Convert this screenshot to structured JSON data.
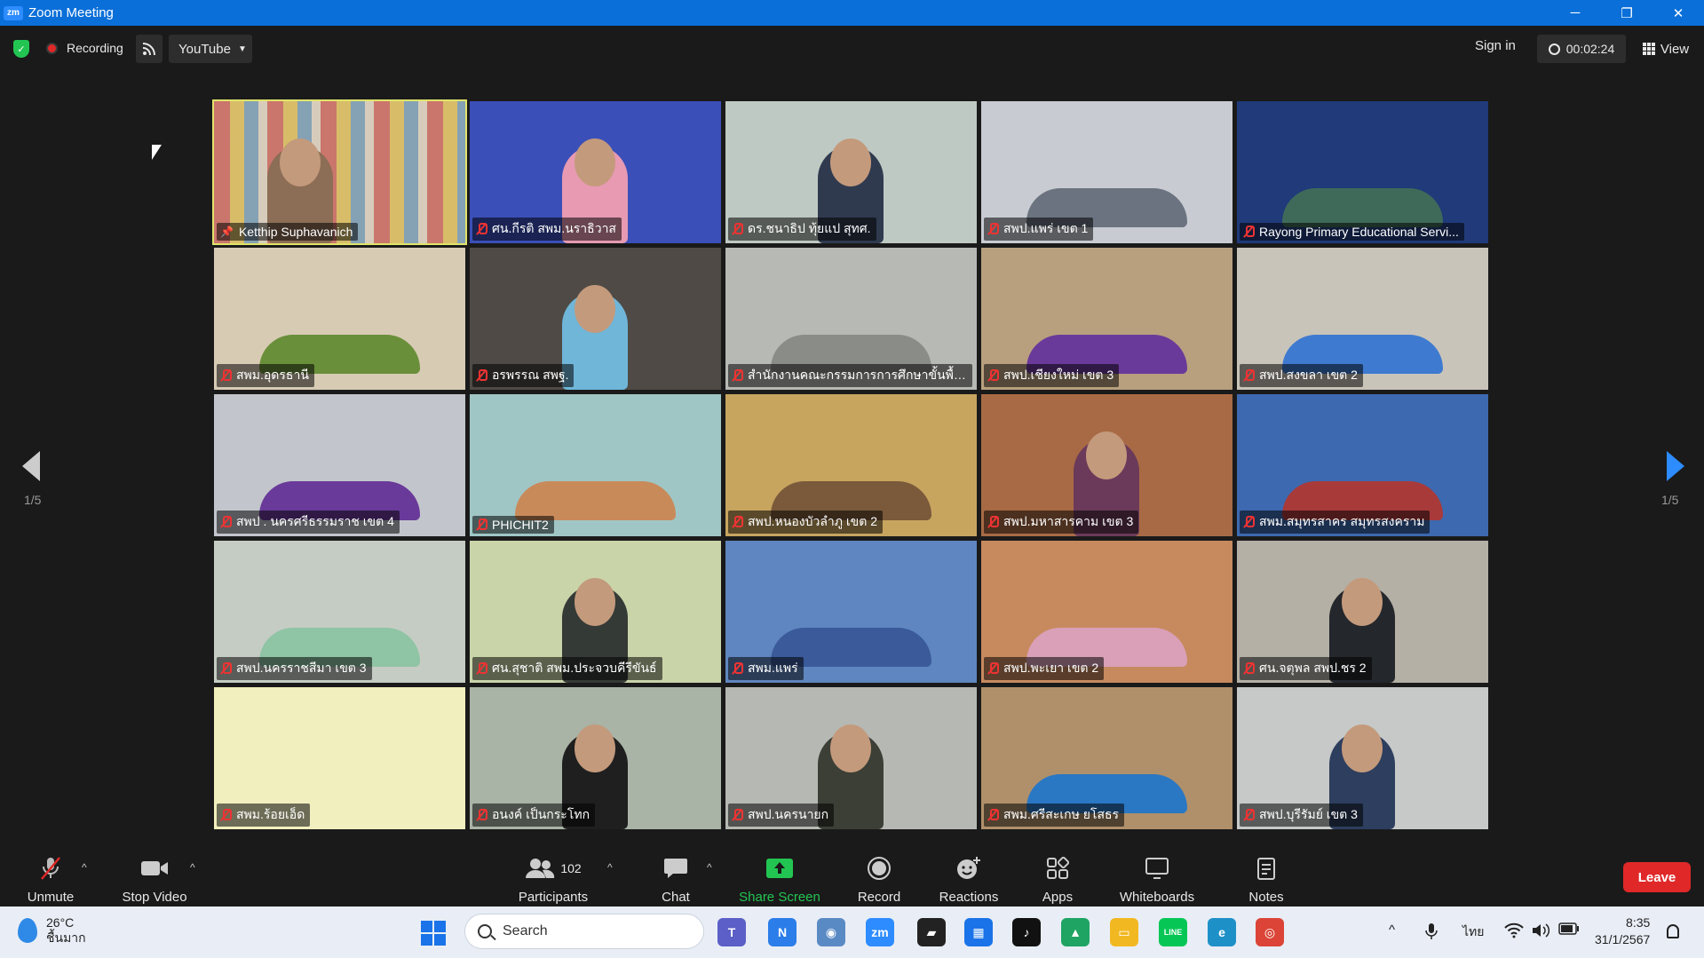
{
  "window": {
    "app_logo": "zm",
    "title": "Zoom Meeting",
    "controls": [
      "─",
      "❐",
      "✕"
    ]
  },
  "topbar": {
    "security_icon": "shield-icon",
    "recording_label": "Recording",
    "stream_icon": "rss-icon",
    "stream_target": "YouTube",
    "sign_in": "Sign in",
    "timer": "00:02:24",
    "view_label": "View"
  },
  "gallery": {
    "page_left": "1/5",
    "page_right": "1/5",
    "tiles": [
      {
        "name": "Ketthip Suphavanich",
        "muted": false,
        "pinned": true,
        "active": true,
        "scene": "books",
        "bg": "#b9a58f",
        "accent": "#8c6d55"
      },
      {
        "name": "ศน.กีรติ สพม.นราธิวาส",
        "muted": true,
        "pinned": false,
        "active": false,
        "scene": "person",
        "bg": "#3b4fb8",
        "accent": "#e79ab2"
      },
      {
        "name": "ดร.ชนาธิป ทุ้ยแป สุทศ.",
        "muted": true,
        "pinned": false,
        "active": false,
        "scene": "person",
        "bg": "#bfc9c3",
        "accent": "#2f3a4f"
      },
      {
        "name": "สพป.แพร่ เขต 1",
        "muted": true,
        "pinned": false,
        "active": false,
        "scene": "room",
        "bg": "#c8ccd2",
        "accent": "#6b7380"
      },
      {
        "name": "Rayong Primary Educational Servi...",
        "muted": true,
        "pinned": false,
        "active": false,
        "scene": "room",
        "bg": "#203a7a",
        "accent": "#3f6a5a"
      },
      {
        "name": "สพม.อุดรธานี",
        "muted": true,
        "pinned": false,
        "active": false,
        "scene": "room",
        "bg": "#d8cbb4",
        "accent": "#6a8f3a"
      },
      {
        "name": "อรพรรณ สพฐ.",
        "muted": true,
        "pinned": false,
        "active": false,
        "scene": "person",
        "bg": "#4f4a45",
        "accent": "#6fb6d9"
      },
      {
        "name": "สำนักงานคณะกรรมการการศึกษาขั้นพื้นฐาน",
        "muted": true,
        "pinned": false,
        "active": false,
        "scene": "room",
        "bg": "#b7b9b4",
        "accent": "#8a8c88"
      },
      {
        "name": "สพป.เชียงใหม่ เขต 3",
        "muted": true,
        "pinned": false,
        "active": false,
        "scene": "room",
        "bg": "#b8a07e",
        "accent": "#6a3a9a"
      },
      {
        "name": "สพป.สงขลา เขต 2",
        "muted": true,
        "pinned": false,
        "active": false,
        "scene": "room",
        "bg": "#c9c4b9",
        "accent": "#3e7ad0"
      },
      {
        "name": "สพป . นครศรีธรรมราช เขต 4",
        "muted": true,
        "pinned": false,
        "active": false,
        "scene": "room",
        "bg": "#c2c6cc",
        "accent": "#6a3a9a"
      },
      {
        "name": "PHICHIT2",
        "muted": true,
        "pinned": false,
        "active": false,
        "scene": "room",
        "bg": "#9fc6c5",
        "accent": "#c98a5a"
      },
      {
        "name": "สพป.หนองบัวลำภู เขต 2",
        "muted": true,
        "pinned": false,
        "active": false,
        "scene": "room",
        "bg": "#c7a55f",
        "accent": "#7a5a3a"
      },
      {
        "name": "สพป.มหาสารคาม เขต 3",
        "muted": true,
        "pinned": false,
        "active": false,
        "scene": "person",
        "bg": "#a86a45",
        "accent": "#6b3a5a"
      },
      {
        "name": "สพม.สมุทรสาคร สมุทรสงคราม",
        "muted": true,
        "pinned": false,
        "active": false,
        "scene": "room",
        "bg": "#3d69b0",
        "accent": "#a83a3a"
      },
      {
        "name": "สพป.นครราชสีมา เขต 3",
        "muted": true,
        "pinned": false,
        "active": false,
        "scene": "room",
        "bg": "#c5ccc4",
        "accent": "#8fc4a4"
      },
      {
        "name": "ศน.สุชาติ สพม.ประจวบคีรีขันธ์",
        "muted": true,
        "pinned": false,
        "active": false,
        "scene": "person",
        "bg": "#c9d4a9",
        "accent": "#343a36"
      },
      {
        "name": "สพม.แพร่",
        "muted": true,
        "pinned": false,
        "active": false,
        "scene": "room",
        "bg": "#5f86c0",
        "accent": "#3a5a9a"
      },
      {
        "name": "สพป.พะเยา เขต 2",
        "muted": true,
        "pinned": false,
        "active": false,
        "scene": "room",
        "bg": "#c78a5f",
        "accent": "#d9a0b8"
      },
      {
        "name": "ศน.จตุพล สพป.ชร 2",
        "muted": true,
        "pinned": false,
        "active": false,
        "scene": "person",
        "bg": "#b4b0a6",
        "accent": "#24272b"
      },
      {
        "name": "สพม.ร้อยเอ็ด",
        "muted": true,
        "pinned": false,
        "active": false,
        "scene": "blank",
        "bg": "#f2efbe",
        "accent": "#ece7a8"
      },
      {
        "name": "อนงค์ เป็นกระโทก",
        "muted": true,
        "pinned": false,
        "active": false,
        "scene": "person",
        "bg": "#a9b3a6",
        "accent": "#1f1f1f"
      },
      {
        "name": "สพป.นครนายก",
        "muted": true,
        "pinned": false,
        "active": false,
        "scene": "person",
        "bg": "#b6b8b3",
        "accent": "#3c3f36"
      },
      {
        "name": "สพม.ศรีสะเกษ ยโสธร",
        "muted": true,
        "pinned": false,
        "active": false,
        "scene": "room",
        "bg": "#b0906a",
        "accent": "#2a77c4"
      },
      {
        "name": "สพป.บุรีรัมย์ เขต 3",
        "muted": true,
        "pinned": false,
        "active": false,
        "scene": "person",
        "bg": "#c6c9c8",
        "accent": "#2d3e5e"
      }
    ]
  },
  "toolbar": {
    "unmute": "Unmute",
    "stop_video": "Stop Video",
    "participants": "Participants",
    "participant_count": "102",
    "chat": "Chat",
    "share_screen": "Share Screen",
    "record": "Record",
    "reactions": "Reactions",
    "apps": "Apps",
    "whiteboards": "Whiteboards",
    "notes": "Notes",
    "leave": "Leave",
    "colors": {
      "share_green": "#23c552",
      "leave_red": "#e02828"
    }
  },
  "taskbar": {
    "temperature": "26°C",
    "weather_desc": "ชื้นมาก",
    "search_placeholder": "Search",
    "apps": [
      {
        "name": "teams",
        "glyph": "T",
        "color": "#5b5fc7"
      },
      {
        "name": "notepad",
        "glyph": "N",
        "color": "#2b7de9"
      },
      {
        "name": "network",
        "glyph": "◉",
        "color": "#5a8ac4"
      },
      {
        "name": "zoom",
        "glyph": "zm",
        "color": "#2d8cff"
      },
      {
        "name": "sticky-notes",
        "glyph": "▰",
        "color": "#222"
      },
      {
        "name": "calculator",
        "glyph": "▦",
        "color": "#1a73e8"
      },
      {
        "name": "tiktok",
        "glyph": "♪",
        "color": "#111"
      },
      {
        "name": "google-drive",
        "glyph": "▲",
        "color": "#1fa463"
      },
      {
        "name": "file-explorer",
        "glyph": "▭",
        "color": "#f2b822"
      },
      {
        "name": "line",
        "glyph": "LINE",
        "color": "#06c755"
      },
      {
        "name": "edge",
        "glyph": "e",
        "color": "#1e90c8"
      },
      {
        "name": "chrome",
        "glyph": "◎",
        "color": "#db4437"
      }
    ],
    "tray": {
      "chevron": "^",
      "mic_icon": "mic-icon",
      "language": "ไทย",
      "wifi_icon": "wifi-icon",
      "volume_icon": "volume-icon",
      "battery_icon": "battery-icon"
    },
    "time": "8:35",
    "date": "31/1/2567"
  }
}
